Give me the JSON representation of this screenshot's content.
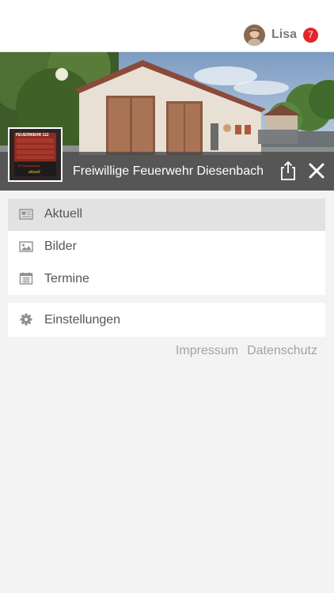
{
  "user": {
    "name": "Lisa",
    "notifications": "7"
  },
  "hero": {
    "title": "Freiwillige Feuerwehr Diesenbach",
    "logo_text": "FEUERWEHR 112",
    "logo_subtext": "FF Diesenbach",
    "logo_caption": "aktuell"
  },
  "menu": [
    {
      "label": "Aktuell",
      "icon": "newspaper-icon",
      "active": true
    },
    {
      "label": "Bilder",
      "icon": "image-icon"
    },
    {
      "label": "Termine",
      "icon": "calendar-icon"
    }
  ],
  "menu2": [
    {
      "label": "Einstellungen",
      "icon": "gear-icon"
    }
  ],
  "footer": {
    "impressum": "Impressum",
    "datenschutz": "Datenschutz"
  },
  "colors": {
    "badge": "#e2262b",
    "active_row": "#e2e2e2",
    "background": "#f3f3f3"
  }
}
